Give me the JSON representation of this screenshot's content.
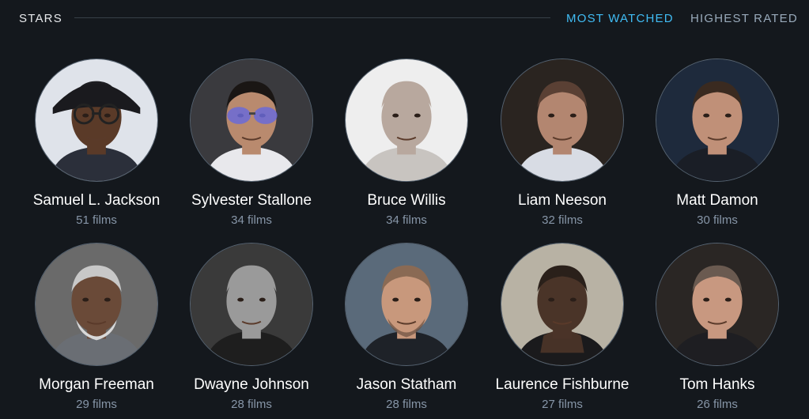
{
  "header": {
    "title": "STARS",
    "tabs": [
      {
        "label": "MOST WATCHED",
        "active": true
      },
      {
        "label": "HIGHEST RATED",
        "active": false
      }
    ]
  },
  "stars": [
    {
      "name": "Samuel L. Jackson",
      "films": "51 films",
      "photo": {
        "bg": "#dfe3ea",
        "skin": "#5a3a28",
        "hair": "#1e1e22",
        "shirt": "#2b2f3a",
        "accessory": "cap-glasses"
      }
    },
    {
      "name": "Sylvester Stallone",
      "films": "34 films",
      "photo": {
        "bg": "#3a3a3e",
        "skin": "#b98a6e",
        "hair": "#1a1614",
        "shirt": "#e8e8ec",
        "accessory": "sunglasses"
      }
    },
    {
      "name": "Bruce Willis",
      "films": "34 films",
      "photo": {
        "bg": "#eeeeee",
        "skin": "#b8a89e",
        "hair": "#b8a89e",
        "shirt": "#c8c4c0",
        "accessory": "none"
      }
    },
    {
      "name": "Liam Neeson",
      "films": "32 films",
      "photo": {
        "bg": "#2a2420",
        "skin": "#b38670",
        "hair": "#5a4034",
        "shirt": "#d8dce4",
        "accessory": "none"
      }
    },
    {
      "name": "Matt Damon",
      "films": "30 films",
      "photo": {
        "bg": "#1e2a3c",
        "skin": "#c09078",
        "hair": "#3a2a20",
        "shirt": "#1a1e26",
        "accessory": "none"
      }
    },
    {
      "name": "Morgan Freeman",
      "films": "29 films",
      "photo": {
        "bg": "#6a6a6a",
        "skin": "#6a4a38",
        "hair": "#c8c8c8",
        "shirt": "#6a6e74",
        "accessory": "beard-white"
      }
    },
    {
      "name": "Dwayne Johnson",
      "films": "28 films",
      "photo": {
        "bg": "#3a3a3a",
        "skin": "#9a9a9a",
        "hair": "#9a9a9a",
        "shirt": "#1e1e1e",
        "accessory": "none"
      }
    },
    {
      "name": "Jason Statham",
      "films": "28 films",
      "photo": {
        "bg": "#5a6a7a",
        "skin": "#c8987c",
        "hair": "#8a6a54",
        "shirt": "#1e2228",
        "accessory": "stubble"
      }
    },
    {
      "name": "Laurence Fishburne",
      "films": "27 films",
      "photo": {
        "bg": "#b8b2a4",
        "skin": "#4a3428",
        "hair": "#2a201a",
        "shirt": "#1a1a1c",
        "accessory": "hands"
      }
    },
    {
      "name": "Tom Hanks",
      "films": "26 films",
      "photo": {
        "bg": "#2a2624",
        "skin": "#c89880",
        "hair": "#6a5a50",
        "shirt": "#1e1e22",
        "accessory": "none"
      }
    }
  ]
}
